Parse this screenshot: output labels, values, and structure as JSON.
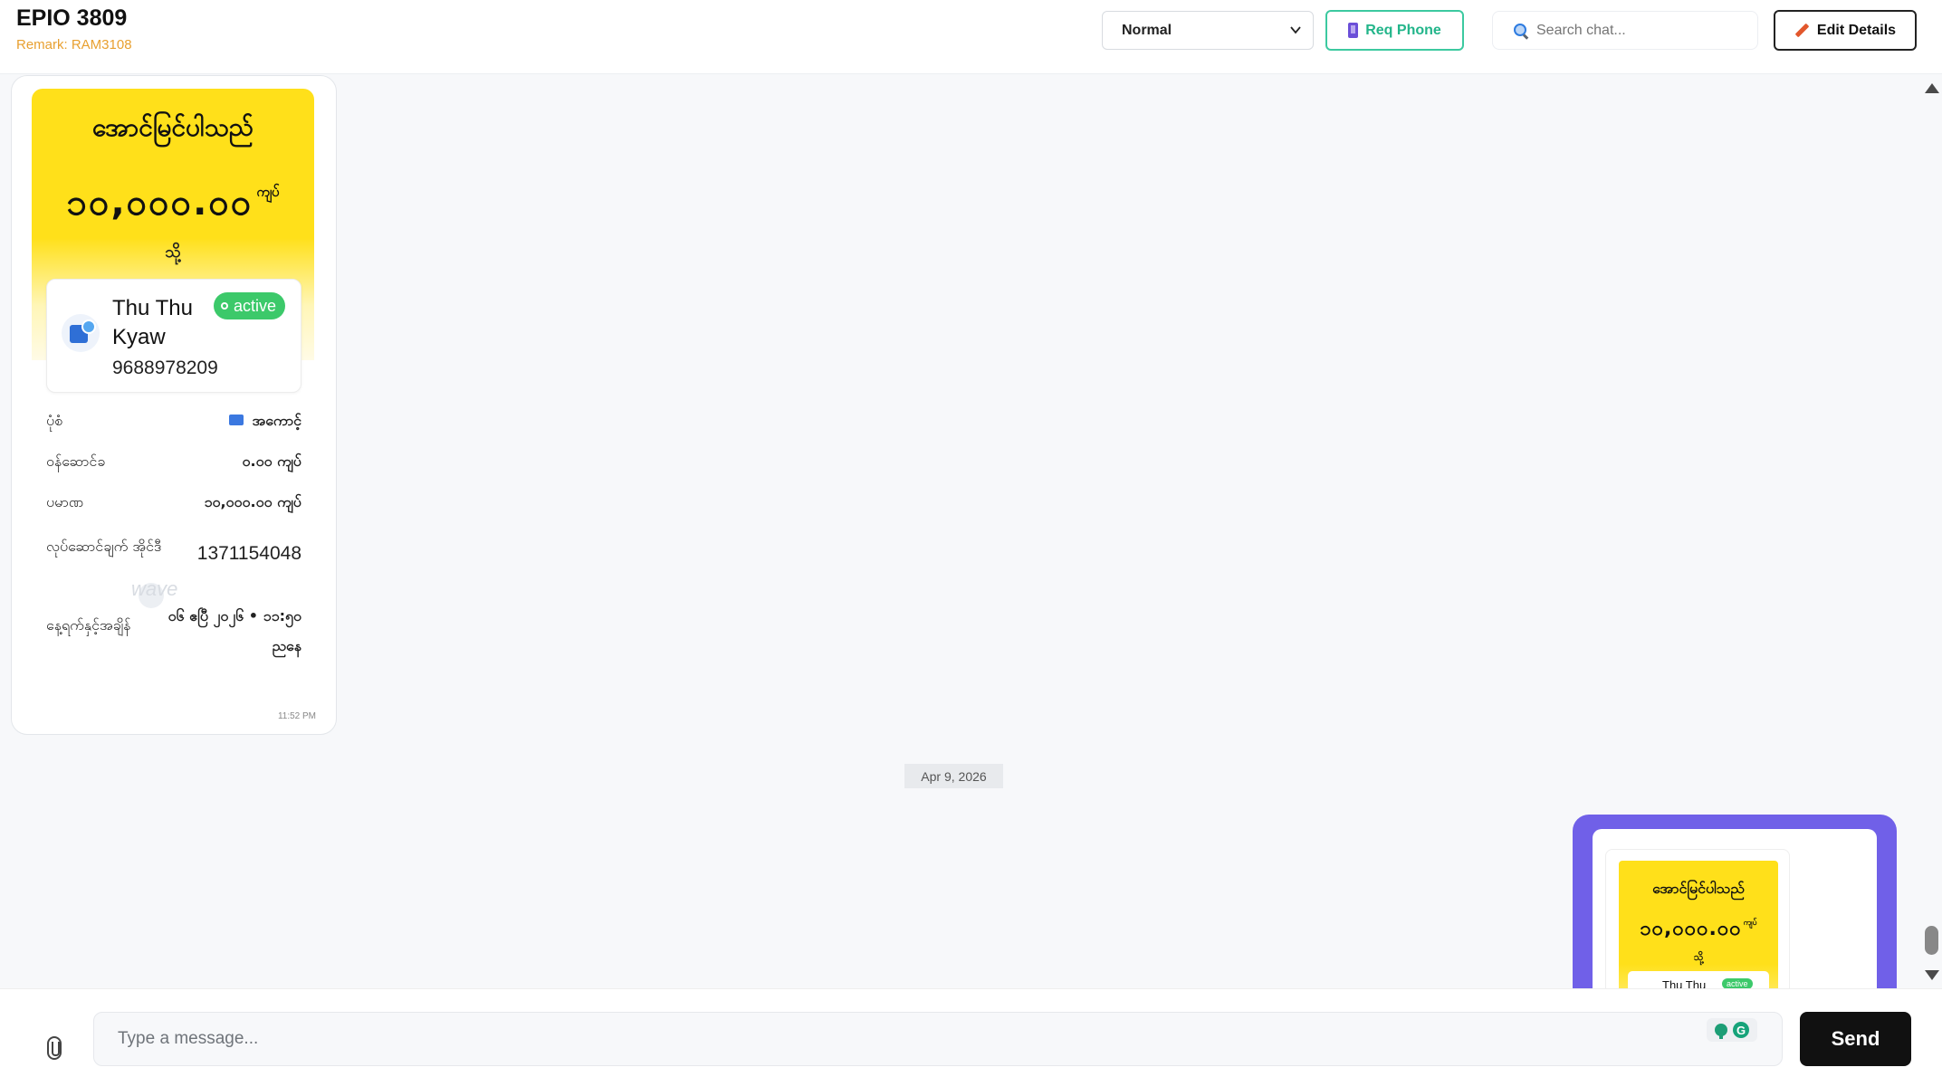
{
  "header": {
    "title": "EPIO 3809",
    "remark": "Remark: RAM3108",
    "priority_select": "Normal",
    "req_phone_label": "Req Phone",
    "search_placeholder": "Search chat...",
    "edit_label": "Edit Details"
  },
  "incoming": {
    "receipt_title": "အောင်မြင်ပါသည်",
    "amount": "၁၀,၀၀၀.၀၀",
    "amount_unit": "ကျပ်",
    "to_label": "သို့",
    "recipient_name": "Thu Thu Kyaw",
    "recipient_status": "active",
    "recipient_phone": "9688978209",
    "rows": [
      {
        "label": "ပုံစံ",
        "value": "အကောင့်"
      },
      {
        "label": "ဝန်ဆောင်ခ",
        "value": "၀.၀၀ ကျပ်"
      },
      {
        "label": "ပမာဏ",
        "value": "၁၀,၀၀၀.၀၀ ကျပ်"
      },
      {
        "label": "လုပ်ဆောင်ချက် အိုင်ဒီ",
        "value": "1371154048"
      },
      {
        "label": "နေ့ရက်နှင့်အချိန်",
        "value": "၀၆ ဧပြီ ၂၀၂၆ • ၁၁:၅၀ ညနေ"
      }
    ],
    "watermark": "wave",
    "time": "11:52 PM"
  },
  "date_separator": "Apr 9, 2026",
  "outgoing": {
    "receipt_title": "အောင်မြင်ပါသည်",
    "amount": "၁၀,၀၀၀.၀၀",
    "amount_unit": "ကျပ်",
    "to_label": "သို့",
    "recipient_name": "Thu Thu",
    "recipient_status": "active"
  },
  "composer": {
    "placeholder": "Type a message...",
    "send_label": "Send"
  },
  "colors": {
    "accent_green": "#3cc9a0",
    "wave_yellow": "#ffe01a",
    "outgoing_bubble": "#7060e8",
    "remark_orange": "#e8a030"
  }
}
